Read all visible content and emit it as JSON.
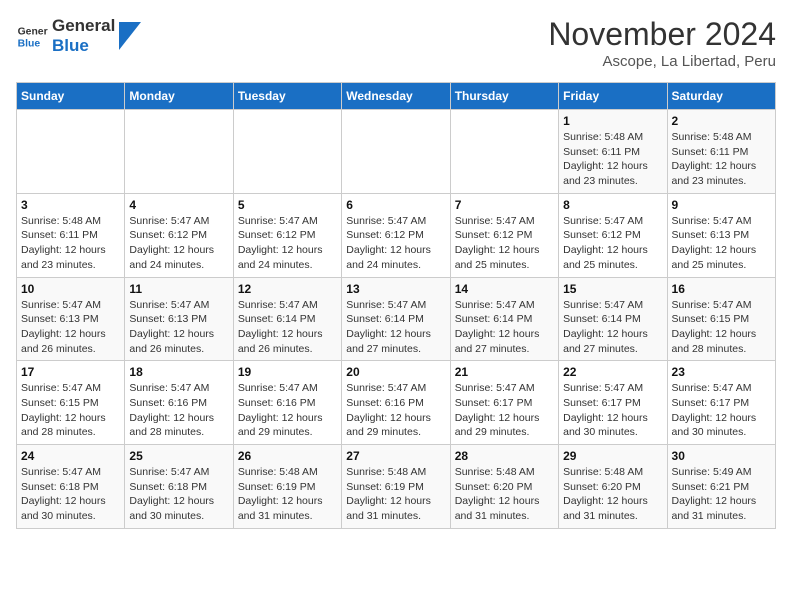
{
  "header": {
    "logo_line1": "General",
    "logo_line2": "Blue",
    "title": "November 2024",
    "subtitle": "Ascope, La Libertad, Peru"
  },
  "calendar": {
    "days_of_week": [
      "Sunday",
      "Monday",
      "Tuesday",
      "Wednesday",
      "Thursday",
      "Friday",
      "Saturday"
    ],
    "weeks": [
      [
        {
          "day": "",
          "info": ""
        },
        {
          "day": "",
          "info": ""
        },
        {
          "day": "",
          "info": ""
        },
        {
          "day": "",
          "info": ""
        },
        {
          "day": "",
          "info": ""
        },
        {
          "day": "1",
          "info": "Sunrise: 5:48 AM\nSunset: 6:11 PM\nDaylight: 12 hours and 23 minutes."
        },
        {
          "day": "2",
          "info": "Sunrise: 5:48 AM\nSunset: 6:11 PM\nDaylight: 12 hours and 23 minutes."
        }
      ],
      [
        {
          "day": "3",
          "info": "Sunrise: 5:48 AM\nSunset: 6:11 PM\nDaylight: 12 hours and 23 minutes."
        },
        {
          "day": "4",
          "info": "Sunrise: 5:47 AM\nSunset: 6:12 PM\nDaylight: 12 hours and 24 minutes."
        },
        {
          "day": "5",
          "info": "Sunrise: 5:47 AM\nSunset: 6:12 PM\nDaylight: 12 hours and 24 minutes."
        },
        {
          "day": "6",
          "info": "Sunrise: 5:47 AM\nSunset: 6:12 PM\nDaylight: 12 hours and 24 minutes."
        },
        {
          "day": "7",
          "info": "Sunrise: 5:47 AM\nSunset: 6:12 PM\nDaylight: 12 hours and 25 minutes."
        },
        {
          "day": "8",
          "info": "Sunrise: 5:47 AM\nSunset: 6:12 PM\nDaylight: 12 hours and 25 minutes."
        },
        {
          "day": "9",
          "info": "Sunrise: 5:47 AM\nSunset: 6:13 PM\nDaylight: 12 hours and 25 minutes."
        }
      ],
      [
        {
          "day": "10",
          "info": "Sunrise: 5:47 AM\nSunset: 6:13 PM\nDaylight: 12 hours and 26 minutes."
        },
        {
          "day": "11",
          "info": "Sunrise: 5:47 AM\nSunset: 6:13 PM\nDaylight: 12 hours and 26 minutes."
        },
        {
          "day": "12",
          "info": "Sunrise: 5:47 AM\nSunset: 6:14 PM\nDaylight: 12 hours and 26 minutes."
        },
        {
          "day": "13",
          "info": "Sunrise: 5:47 AM\nSunset: 6:14 PM\nDaylight: 12 hours and 27 minutes."
        },
        {
          "day": "14",
          "info": "Sunrise: 5:47 AM\nSunset: 6:14 PM\nDaylight: 12 hours and 27 minutes."
        },
        {
          "day": "15",
          "info": "Sunrise: 5:47 AM\nSunset: 6:14 PM\nDaylight: 12 hours and 27 minutes."
        },
        {
          "day": "16",
          "info": "Sunrise: 5:47 AM\nSunset: 6:15 PM\nDaylight: 12 hours and 28 minutes."
        }
      ],
      [
        {
          "day": "17",
          "info": "Sunrise: 5:47 AM\nSunset: 6:15 PM\nDaylight: 12 hours and 28 minutes."
        },
        {
          "day": "18",
          "info": "Sunrise: 5:47 AM\nSunset: 6:16 PM\nDaylight: 12 hours and 28 minutes."
        },
        {
          "day": "19",
          "info": "Sunrise: 5:47 AM\nSunset: 6:16 PM\nDaylight: 12 hours and 29 minutes."
        },
        {
          "day": "20",
          "info": "Sunrise: 5:47 AM\nSunset: 6:16 PM\nDaylight: 12 hours and 29 minutes."
        },
        {
          "day": "21",
          "info": "Sunrise: 5:47 AM\nSunset: 6:17 PM\nDaylight: 12 hours and 29 minutes."
        },
        {
          "day": "22",
          "info": "Sunrise: 5:47 AM\nSunset: 6:17 PM\nDaylight: 12 hours and 30 minutes."
        },
        {
          "day": "23",
          "info": "Sunrise: 5:47 AM\nSunset: 6:17 PM\nDaylight: 12 hours and 30 minutes."
        }
      ],
      [
        {
          "day": "24",
          "info": "Sunrise: 5:47 AM\nSunset: 6:18 PM\nDaylight: 12 hours and 30 minutes."
        },
        {
          "day": "25",
          "info": "Sunrise: 5:47 AM\nSunset: 6:18 PM\nDaylight: 12 hours and 30 minutes."
        },
        {
          "day": "26",
          "info": "Sunrise: 5:48 AM\nSunset: 6:19 PM\nDaylight: 12 hours and 31 minutes."
        },
        {
          "day": "27",
          "info": "Sunrise: 5:48 AM\nSunset: 6:19 PM\nDaylight: 12 hours and 31 minutes."
        },
        {
          "day": "28",
          "info": "Sunrise: 5:48 AM\nSunset: 6:20 PM\nDaylight: 12 hours and 31 minutes."
        },
        {
          "day": "29",
          "info": "Sunrise: 5:48 AM\nSunset: 6:20 PM\nDaylight: 12 hours and 31 minutes."
        },
        {
          "day": "30",
          "info": "Sunrise: 5:49 AM\nSunset: 6:21 PM\nDaylight: 12 hours and 31 minutes."
        }
      ]
    ]
  }
}
